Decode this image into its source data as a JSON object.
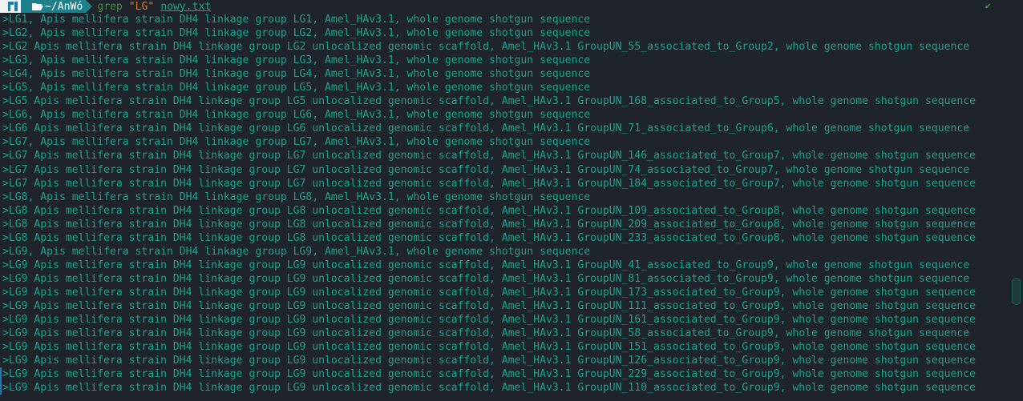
{
  "prompt": {
    "os_icon": "manjaro-logo-icon",
    "folder_icon": "folder-open-icon",
    "directory": "~/AnWó",
    "command": "grep",
    "pattern": "\"LG\"",
    "file": "nowy.txt",
    "status_icon": "checkmark-icon",
    "status_glyph": "✔"
  },
  "output": [
    {
      "text": ">LG1, Apis mellifera strain DH4 linkage group LG1, Amel_HAv3.1, whole genome shotgun sequence",
      "marked": false
    },
    {
      "text": ">LG2, Apis mellifera strain DH4 linkage group LG2, Amel_HAv3.1, whole genome shotgun sequence",
      "marked": false
    },
    {
      "text": ">LG2 Apis mellifera strain DH4 linkage group LG2 unlocalized genomic scaffold, Amel_HAv3.1 GroupUN_55_associated_to_Group2, whole genome shotgun sequence",
      "marked": false
    },
    {
      "text": ">LG3, Apis mellifera strain DH4 linkage group LG3, Amel_HAv3.1, whole genome shotgun sequence",
      "marked": false
    },
    {
      "text": ">LG4, Apis mellifera strain DH4 linkage group LG4, Amel_HAv3.1, whole genome shotgun sequence",
      "marked": false
    },
    {
      "text": ">LG5, Apis mellifera strain DH4 linkage group LG5, Amel_HAv3.1, whole genome shotgun sequence",
      "marked": false
    },
    {
      "text": ">LG5 Apis mellifera strain DH4 linkage group LG5 unlocalized genomic scaffold, Amel_HAv3.1 GroupUN_168_associated_to_Group5, whole genome shotgun sequence",
      "marked": false
    },
    {
      "text": ">LG6, Apis mellifera strain DH4 linkage group LG6, Amel_HAv3.1, whole genome shotgun sequence",
      "marked": false
    },
    {
      "text": ">LG6 Apis mellifera strain DH4 linkage group LG6 unlocalized genomic scaffold, Amel_HAv3.1 GroupUN_71_associated_to_Group6, whole genome shotgun sequence",
      "marked": false
    },
    {
      "text": ">LG7, Apis mellifera strain DH4 linkage group LG7, Amel_HAv3.1, whole genome shotgun sequence",
      "marked": false
    },
    {
      "text": ">LG7 Apis mellifera strain DH4 linkage group LG7 unlocalized genomic scaffold, Amel_HAv3.1 GroupUN_146_associated_to_Group7, whole genome shotgun sequence",
      "marked": false
    },
    {
      "text": ">LG7 Apis mellifera strain DH4 linkage group LG7 unlocalized genomic scaffold, Amel_HAv3.1 GroupUN_74_associated_to_Group7, whole genome shotgun sequence",
      "marked": false
    },
    {
      "text": ">LG7 Apis mellifera strain DH4 linkage group LG7 unlocalized genomic scaffold, Amel_HAv3.1 GroupUN_184_associated_to_Group7, whole genome shotgun sequence",
      "marked": false
    },
    {
      "text": ">LG8, Apis mellifera strain DH4 linkage group LG8, Amel_HAv3.1, whole genome shotgun sequence",
      "marked": false
    },
    {
      "text": ">LG8 Apis mellifera strain DH4 linkage group LG8 unlocalized genomic scaffold, Amel_HAv3.1 GroupUN_109_associated_to_Group8, whole genome shotgun sequence",
      "marked": false
    },
    {
      "text": ">LG8 Apis mellifera strain DH4 linkage group LG8 unlocalized genomic scaffold, Amel_HAv3.1 GroupUN_209_associated_to_Group8, whole genome shotgun sequence",
      "marked": false
    },
    {
      "text": ">LG8 Apis mellifera strain DH4 linkage group LG8 unlocalized genomic scaffold, Amel_HAv3.1 GroupUN_233_associated_to_Group8, whole genome shotgun sequence",
      "marked": false
    },
    {
      "text": ">LG9, Apis mellifera strain DH4 linkage group LG9, Amel_HAv3.1, whole genome shotgun sequence",
      "marked": false
    },
    {
      "text": ">LG9 Apis mellifera strain DH4 linkage group LG9 unlocalized genomic scaffold, Amel_HAv3.1 GroupUN_41_associated_to_Group9, whole genome shotgun sequence",
      "marked": false
    },
    {
      "text": ">LG9 Apis mellifera strain DH4 linkage group LG9 unlocalized genomic scaffold, Amel_HAv3.1 GroupUN_81_associated_to_Group9, whole genome shotgun sequence",
      "marked": false
    },
    {
      "text": ">LG9 Apis mellifera strain DH4 linkage group LG9 unlocalized genomic scaffold, Amel_HAv3.1 GroupUN_173_associated_to_Group9, whole genome shotgun sequence",
      "marked": false
    },
    {
      "text": ">LG9 Apis mellifera strain DH4 linkage group LG9 unlocalized genomic scaffold, Amel_HAv3.1 GroupUN_111_associated_to_Group9, whole genome shotgun sequence",
      "marked": false
    },
    {
      "text": ">LG9 Apis mellifera strain DH4 linkage group LG9 unlocalized genomic scaffold, Amel_HAv3.1 GroupUN_161_associated_to_Group9, whole genome shotgun sequence",
      "marked": false
    },
    {
      "text": ">LG9 Apis mellifera strain DH4 linkage group LG9 unlocalized genomic scaffold, Amel_HAv3.1 GroupUN_58_associated_to_Group9, whole genome shotgun sequence",
      "marked": false
    },
    {
      "text": ">LG9 Apis mellifera strain DH4 linkage group LG9 unlocalized genomic scaffold, Amel_HAv3.1 GroupUN_151_associated_to_Group9, whole genome shotgun sequence",
      "marked": false
    },
    {
      "text": ">LG9 Apis mellifera strain DH4 linkage group LG9 unlocalized genomic scaffold, Amel_HAv3.1 GroupUN_126_associated_to_Group9, whole genome shotgun sequence",
      "marked": false
    },
    {
      "text": ">LG9 Apis mellifera strain DH4 linkage group LG9 unlocalized genomic scaffold, Amel_HAv3.1 GroupUN_229_associated_to_Group9, whole genome shotgun sequence",
      "marked": true
    },
    {
      "text": ">LG9 Apis mellifera strain DH4 linkage group LG9 unlocalized genomic scaffold, Amel_HAv3.1 GroupUN_110_associated_to_Group9, whole genome shotgun sequence",
      "marked": true
    }
  ],
  "colors": {
    "background": "#1f232b",
    "output_text": "#1ba38a",
    "command": "#3e8f2e",
    "string": "#e07a1f",
    "dir_segment": "#1c7f8a",
    "marker": "#1f7ab5"
  }
}
